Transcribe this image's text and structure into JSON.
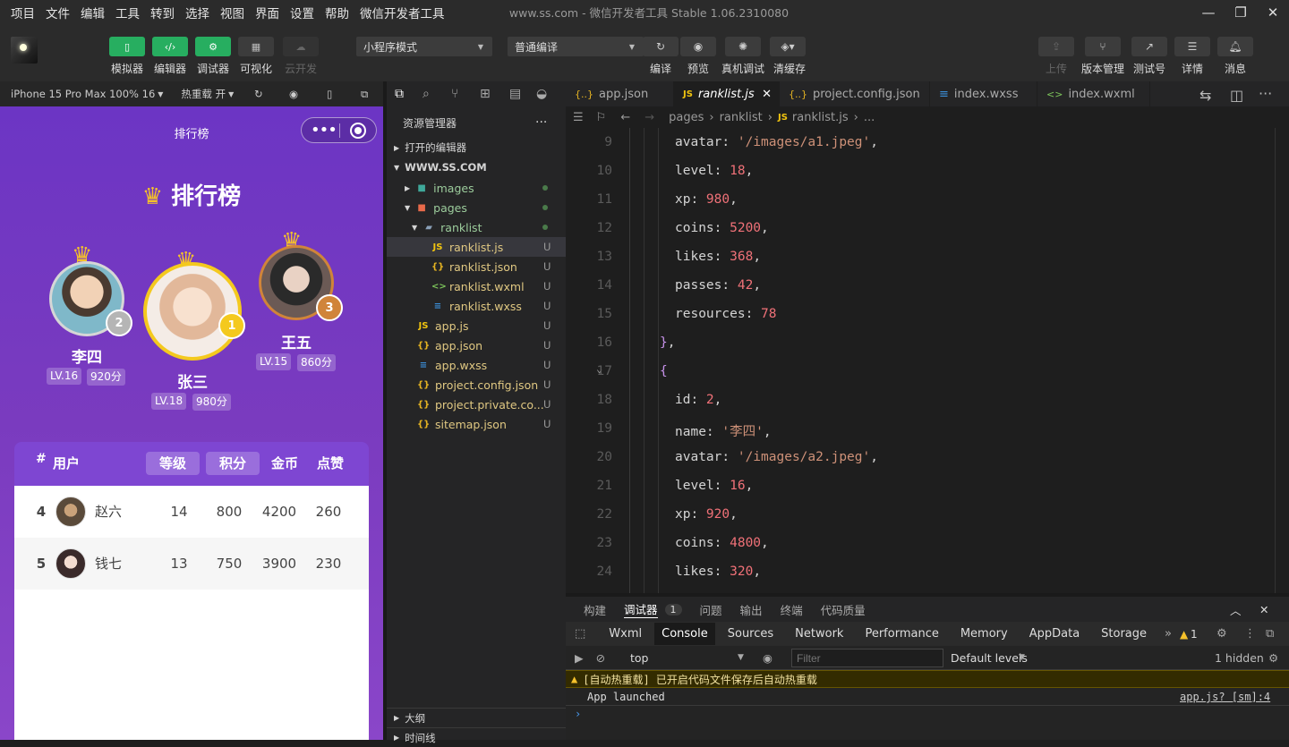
{
  "menubar": {
    "items": [
      "项目",
      "文件",
      "编辑",
      "工具",
      "转到",
      "选择",
      "视图",
      "界面",
      "设置",
      "帮助",
      "微信开发者工具"
    ],
    "title": "www.ss.com - 微信开发者工具 Stable 1.06.2310080"
  },
  "toolbar": {
    "left": [
      {
        "label": "模拟器",
        "icon": "phone-icon"
      },
      {
        "label": "编辑器",
        "icon": "code-icon"
      },
      {
        "label": "调试器",
        "icon": "debug-icon"
      },
      {
        "label": "可视化",
        "icon": "layout-icon"
      },
      {
        "label": "云开发",
        "icon": "cloud-icon"
      }
    ],
    "mode": "小程序模式",
    "compile": "普通编译",
    "actions": [
      {
        "label": "编译",
        "icon": "refresh-icon"
      },
      {
        "label": "预览",
        "icon": "eye-icon"
      },
      {
        "label": "真机调试",
        "icon": "bug-icon"
      },
      {
        "label": "清缓存",
        "icon": "layers-icon"
      }
    ],
    "right": [
      {
        "label": "上传",
        "icon": "upload-icon"
      },
      {
        "label": "版本管理",
        "icon": "branch-icon"
      },
      {
        "label": "测试号",
        "icon": "external-icon"
      },
      {
        "label": "详情",
        "icon": "menu-icon"
      },
      {
        "label": "消息",
        "icon": "bell-icon"
      }
    ]
  },
  "simulator": {
    "device": "iPhone 15 Pro Max 100% 16",
    "hotreload": "热重载 开"
  },
  "phone": {
    "nav_title": "排行榜",
    "title": "排行榜",
    "podium": [
      {
        "rank": "2",
        "name": "李四",
        "level": "LV.16",
        "score": "920分"
      },
      {
        "rank": "1",
        "name": "张三",
        "level": "LV.18",
        "score": "980分"
      },
      {
        "rank": "3",
        "name": "王五",
        "level": "LV.15",
        "score": "860分"
      }
    ],
    "table_headers": {
      "hash": "#",
      "user": "用户",
      "level": "等级",
      "score": "积分",
      "coins": "金币",
      "likes": "点赞"
    },
    "rows": [
      {
        "rank": "4",
        "name": "赵六",
        "level": "14",
        "score": "800",
        "coins": "4200",
        "likes": "260"
      },
      {
        "rank": "5",
        "name": "钱七",
        "level": "13",
        "score": "750",
        "coins": "3900",
        "likes": "230"
      }
    ]
  },
  "explorer": {
    "title": "资源管理器",
    "open_editors": "打开的编辑器",
    "root": "WWW.SS.COM",
    "files": [
      {
        "name": "images",
        "type": "folder",
        "badge": "dot"
      },
      {
        "name": "pages",
        "type": "folder",
        "badge": "dot"
      },
      {
        "name": "ranklist",
        "type": "folder",
        "badge": "dot"
      },
      {
        "name": "ranklist.js",
        "type": "js",
        "badge": "U"
      },
      {
        "name": "ranklist.json",
        "type": "json",
        "badge": "U"
      },
      {
        "name": "ranklist.wxml",
        "type": "wxml",
        "badge": "U"
      },
      {
        "name": "ranklist.wxss",
        "type": "wxss",
        "badge": "U"
      },
      {
        "name": "app.js",
        "type": "js",
        "badge": "U"
      },
      {
        "name": "app.json",
        "type": "json",
        "badge": "U"
      },
      {
        "name": "app.wxss",
        "type": "wxss",
        "badge": "U"
      },
      {
        "name": "project.config.json",
        "type": "json",
        "badge": "U"
      },
      {
        "name": "project.private.co...",
        "type": "json",
        "badge": "U"
      },
      {
        "name": "sitemap.json",
        "type": "json",
        "badge": "U"
      }
    ],
    "outline": "大纲",
    "timeline": "时间线"
  },
  "editor": {
    "tabs": [
      {
        "name": "app.json",
        "icon": "{..}"
      },
      {
        "name": "ranklist.js",
        "icon": "JS"
      },
      {
        "name": "project.config.json",
        "icon": "{..}"
      },
      {
        "name": "index.wxss",
        "icon": "≡"
      },
      {
        "name": "index.wxml",
        "icon": "<>"
      }
    ],
    "breadcrumb": [
      "pages",
      "ranklist",
      "ranklist.js",
      "..."
    ],
    "lines": [
      {
        "n": "9",
        "k": "avatar: ",
        "v": "'/images/a1.jpeg'",
        "t": "s",
        "e": ","
      },
      {
        "n": "10",
        "k": "level: ",
        "v": "18",
        "t": "n",
        "e": ","
      },
      {
        "n": "11",
        "k": "xp: ",
        "v": "980",
        "t": "n",
        "e": ","
      },
      {
        "n": "12",
        "k": "coins: ",
        "v": "5200",
        "t": "n",
        "e": ","
      },
      {
        "n": "13",
        "k": "likes: ",
        "v": "368",
        "t": "n",
        "e": ","
      },
      {
        "n": "14",
        "k": "passes: ",
        "v": "42",
        "t": "n",
        "e": ","
      },
      {
        "n": "15",
        "k": "resources: ",
        "v": "78",
        "t": "n",
        "e": ""
      },
      {
        "n": "16",
        "k": "",
        "v": "}",
        "t": "p",
        "e": ","
      },
      {
        "n": "17",
        "k": "",
        "v": "{",
        "t": "p",
        "e": ""
      },
      {
        "n": "18",
        "k": "id: ",
        "v": "2",
        "t": "n",
        "e": ","
      },
      {
        "n": "19",
        "k": "name: ",
        "v": "'李四'",
        "t": "s",
        "e": ","
      },
      {
        "n": "20",
        "k": "avatar: ",
        "v": "'/images/a2.jpeg'",
        "t": "s",
        "e": ","
      },
      {
        "n": "21",
        "k": "level: ",
        "v": "16",
        "t": "n",
        "e": ","
      },
      {
        "n": "22",
        "k": "xp: ",
        "v": "920",
        "t": "n",
        "e": ","
      },
      {
        "n": "23",
        "k": "coins: ",
        "v": "4800",
        "t": "n",
        "e": ","
      },
      {
        "n": "24",
        "k": "likes: ",
        "v": "320",
        "t": "n",
        "e": ","
      }
    ]
  },
  "devtools": {
    "top_tabs": [
      "构建",
      "调试器",
      "问题",
      "输出",
      "终端",
      "代码质量"
    ],
    "debug_count": "1",
    "tabs": [
      "Wxml",
      "Console",
      "Sources",
      "Network",
      "Performance",
      "Memory",
      "AppData",
      "Storage"
    ],
    "warn_count": "1",
    "context": "top",
    "filter_placeholder": "Filter",
    "levels": "Default levels",
    "hidden": "1 hidden",
    "warn_msg": "[自动热重载] 已开启代码文件保存后自动热重载",
    "log_msg": "App launched",
    "log_src": "app.js? [sm]:4"
  }
}
